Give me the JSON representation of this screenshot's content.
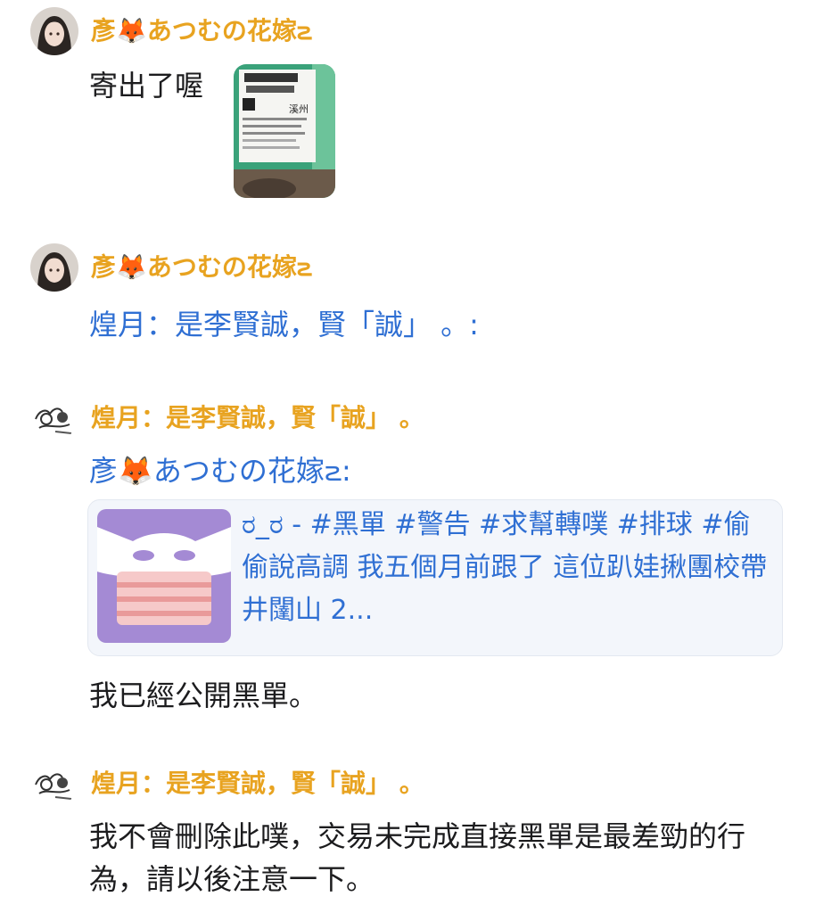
{
  "messages": [
    {
      "author": "彥🦊あつむの花嫁౽",
      "text": "寄出了喔",
      "avatar": "anime-girl-avatar",
      "attachment": "shipping-package-photo",
      "package_text": "溪州"
    },
    {
      "author": "彥🦊あつむの花嫁౽",
      "mention": "煌月：是李賢誠，賢「誠」 。:",
      "avatar": "anime-girl-avatar"
    },
    {
      "author": "煌月：是李賢誠，賢「誠」 。",
      "mention": "彥🦊あつむの花嫁౽:",
      "avatar": "sketch-avatar",
      "link_card": {
        "text": "ರ_ರ - #黑單 #警告 #求幫轉噗 #排球 #偷偷說高調 我五個月前跟了 這位趴娃揪團校帶井闥山 2...",
        "image": "masked-face-thumbnail"
      },
      "text": "我已經公開黑單。"
    },
    {
      "author": "煌月：是李賢誠，賢「誠」 。",
      "avatar": "sketch-avatar",
      "text": "我不會刪除此噗，交易未完成直接黑單是最差勁的行為，請以後注意一下。"
    }
  ],
  "colors": {
    "author": "#e8a320",
    "link": "#2f6fd3",
    "text": "#1c1c1e",
    "card_bg": "#f3f6fb",
    "card_img_bg": "#a48ad4"
  }
}
